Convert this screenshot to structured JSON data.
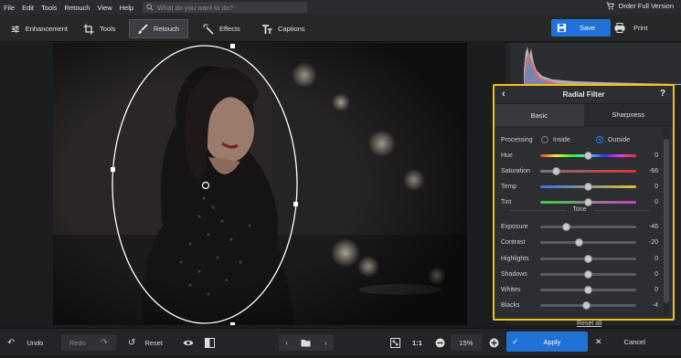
{
  "menu": [
    "File",
    "Edit",
    "Tools",
    "Retouch",
    "View",
    "Help"
  ],
  "search": {
    "placeholder": "What do you want to do?"
  },
  "order_label": "Order Full Version",
  "tabs": [
    {
      "label": "Enhancement",
      "icon": "sliders-icon"
    },
    {
      "label": "Tools",
      "icon": "crop-icon"
    },
    {
      "label": "Retouch",
      "icon": "brush-icon",
      "active": true
    },
    {
      "label": "Effects",
      "icon": "magic-wand-icon"
    },
    {
      "label": "Captions",
      "icon": "text-icon"
    }
  ],
  "save_label": "Save",
  "print_label": "Print",
  "filter": {
    "title": "Radial Filter",
    "tabs": [
      "Basic",
      "Sharpness"
    ],
    "processing": {
      "label": "Processing",
      "options": [
        "Inside",
        "Outside"
      ],
      "selected": "Outside"
    },
    "color_sliders": [
      {
        "label": "Hue",
        "value": "0",
        "pos": 0.5
      },
      {
        "label": "Saturation",
        "value": "-66",
        "pos": 0.17
      },
      {
        "label": "Temp",
        "value": "0",
        "pos": 0.5
      },
      {
        "label": "Tint",
        "value": "0",
        "pos": 0.5
      }
    ],
    "tone_label": "Tone",
    "tone_sliders": [
      {
        "label": "Exposure",
        "value": "-46",
        "pos": 0.27
      },
      {
        "label": "Contrast",
        "value": "-20",
        "pos": 0.4
      },
      {
        "label": "Highlights",
        "value": "0",
        "pos": 0.5
      },
      {
        "label": "Shadows",
        "value": "0",
        "pos": 0.5
      },
      {
        "label": "Whites",
        "value": "0",
        "pos": 0.5
      },
      {
        "label": "Blacks",
        "value": "-4",
        "pos": 0.48
      }
    ]
  },
  "reset_all": "Reset all",
  "bottom": {
    "undo": "Undo",
    "redo": "Redo",
    "reset": "Reset",
    "ratio": "1:1",
    "zoom": "15%",
    "apply": "Apply",
    "cancel": "Cancel"
  },
  "colors": {
    "accent": "#2172d6",
    "highlight_border": "#f2c11d"
  }
}
